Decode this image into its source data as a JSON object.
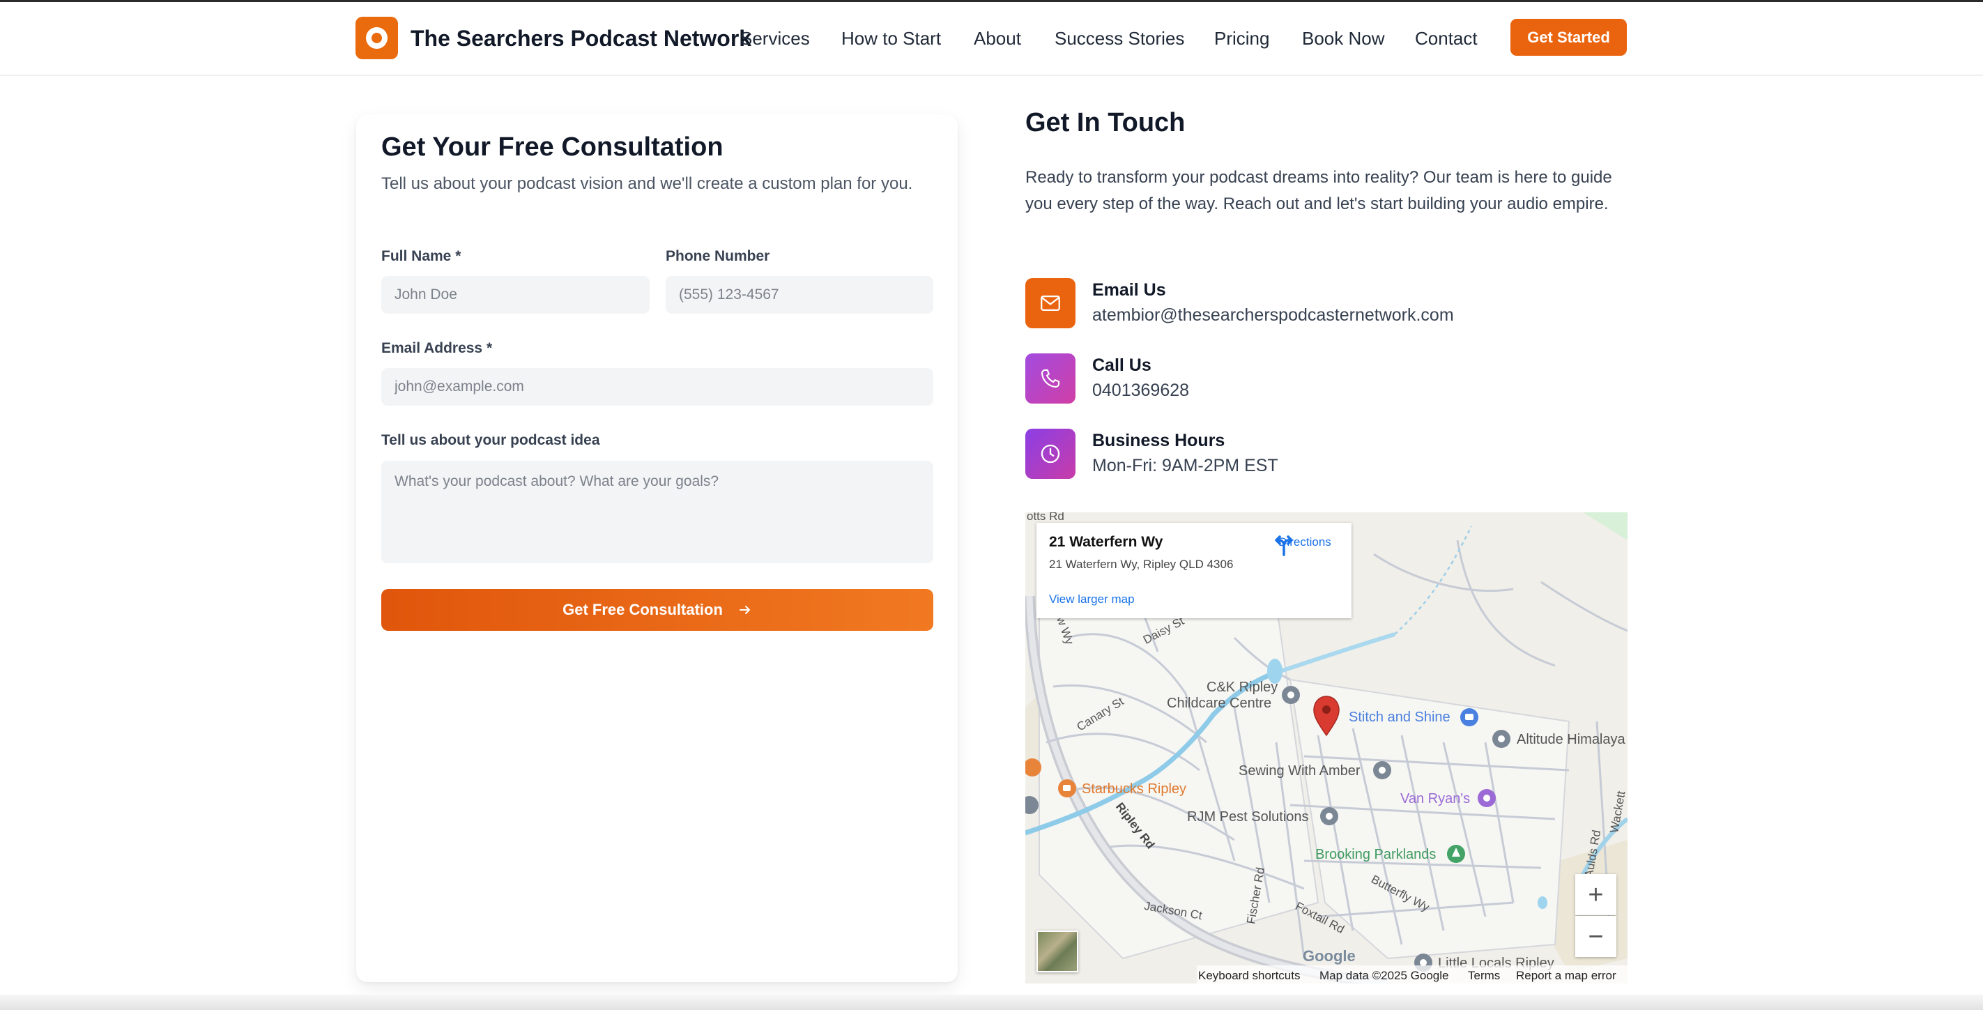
{
  "header": {
    "brand": "The Searchers Podcast Network",
    "nav": [
      "Services",
      "How to Start",
      "About",
      "Success Stories",
      "Pricing",
      "Book Now",
      "Contact"
    ],
    "cta": "Get Started"
  },
  "form": {
    "title": "Get Your Free Consultation",
    "subtitle": "Tell us about your podcast vision and we'll create a custom plan for you.",
    "full_name_label": "Full Name *",
    "full_name_placeholder": "John Doe",
    "phone_label": "Phone Number",
    "phone_placeholder": "(555) 123-4567",
    "email_label": "Email Address *",
    "email_placeholder": "john@example.com",
    "idea_label": "Tell us about your podcast idea",
    "idea_placeholder": "What's your podcast about? What are your goals?",
    "submit": "Get Free Consultation"
  },
  "contact": {
    "title": "Get In Touch",
    "intro": "Ready to transform your podcast dreams into reality? Our team is here to guide you every step of the way. Reach out and let's start building your audio empire.",
    "items": [
      {
        "label": "Email Us",
        "value": "atembior@thesearcherspodcasternetwork.com",
        "icon": "mail-icon"
      },
      {
        "label": "Call Us",
        "value": "0401369628",
        "icon": "phone-icon"
      },
      {
        "label": "Business Hours",
        "value": "Mon-Fri: 9AM-2PM EST",
        "icon": "clock-icon"
      }
    ]
  },
  "map": {
    "card_title": "21 Waterfern Wy",
    "card_address": "21 Waterfern Wy, Ripley QLD 4306",
    "directions": "Directions",
    "larger_map": "View larger map",
    "places": [
      "C&K Ripley",
      "Childcare Centre",
      "Stitch and Shine",
      "Altitude Himalaya",
      "Sewing With Amber",
      "Starbucks Ripley",
      "Van Ryan's",
      "RJM Pest Solutions",
      "Brooking Parklands",
      "Little Locals Ripley"
    ],
    "roads": [
      "otts Rd",
      "Daisy St",
      "rrow Wy",
      "Canary St",
      "Ripley Rd",
      "Fischer Rd",
      "Butterfly Wy",
      "Foxtail Rd",
      "Jackson Ct",
      "Aulds Rd",
      "Wackett"
    ],
    "google": "Google",
    "footer": [
      "Keyboard shortcuts",
      "Map data ©2025 Google",
      "Terms",
      "Report a map error"
    ],
    "zoom_in": "+",
    "zoom_out": "−"
  },
  "colors": {
    "accent": "#ea640f",
    "phone_icon_bg": "#b844c8",
    "clock_icon_bg": "#9a3ee0",
    "pin": "#d93b30"
  }
}
